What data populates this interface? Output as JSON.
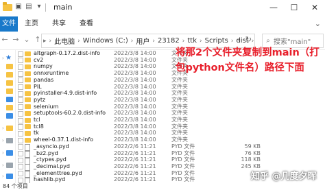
{
  "window": {
    "title": "main",
    "controls": [
      "—",
      "☐",
      "✕"
    ]
  },
  "ribbon": {
    "file_tab": "文件",
    "tabs": [
      "主页",
      "共享",
      "查看"
    ],
    "expand_icon": "chevron-down-icon"
  },
  "address_bar": {
    "segments": [
      "此电脑",
      "Windows (C:)",
      "用户",
      "23182",
      "ttk",
      "Scripts",
      "dist"
    ],
    "current": "main",
    "dropdown_glyph": "⌄",
    "refresh_glyph": "↻"
  },
  "search": {
    "placeholder": "搜索\"main\""
  },
  "files": [
    {
      "name": "altgraph-0.17.2.dist-info",
      "date": "2022/3/8 14:00",
      "type": "文件夹",
      "size": "",
      "kind": "folder"
    },
    {
      "name": "cv2",
      "date": "2022/3/8 14:00",
      "type": "文件夹",
      "size": "",
      "kind": "folder"
    },
    {
      "name": "numpy",
      "date": "2022/3/8 14:00",
      "type": "文件夹",
      "size": "",
      "kind": "folder"
    },
    {
      "name": "onnxruntime",
      "date": "2022/3/8 14:00",
      "type": "文件夹",
      "size": "",
      "kind": "folder"
    },
    {
      "name": "pandas",
      "date": "2022/3/8 14:00",
      "type": "文件夹",
      "size": "",
      "kind": "folder"
    },
    {
      "name": "PIL",
      "date": "2022/3/8 14:00",
      "type": "文件夹",
      "size": "",
      "kind": "folder"
    },
    {
      "name": "pyinstaller-4.9.dist-info",
      "date": "2022/3/8 14:00",
      "type": "文件夹",
      "size": "",
      "kind": "folder"
    },
    {
      "name": "pytz",
      "date": "2022/3/8 14:00",
      "type": "文件夹",
      "size": "",
      "kind": "folder"
    },
    {
      "name": "selenium",
      "date": "2022/3/8 14:00",
      "type": "文件夹",
      "size": "",
      "kind": "folder"
    },
    {
      "name": "setuptools-60.2.0.dist-info",
      "date": "2022/3/8 14:00",
      "type": "文件夹",
      "size": "",
      "kind": "folder"
    },
    {
      "name": "tcl",
      "date": "2022/3/8 14:00",
      "type": "文件夹",
      "size": "",
      "kind": "folder"
    },
    {
      "name": "tcl8",
      "date": "2022/3/8 14:00",
      "type": "文件夹",
      "size": "",
      "kind": "folder"
    },
    {
      "name": "tk",
      "date": "2022/3/8 14:00",
      "type": "文件夹",
      "size": "",
      "kind": "folder"
    },
    {
      "name": "wheel-0.37.1.dist-info",
      "date": "2022/3/8 14:00",
      "type": "文件夹",
      "size": "",
      "kind": "folder"
    },
    {
      "name": "_asyncio.pyd",
      "date": "2022/2/6 11:21",
      "type": "PYD 文件",
      "size": "59 KB",
      "kind": "file"
    },
    {
      "name": "_bz2.pyd",
      "date": "2022/2/6 11:21",
      "type": "PYD 文件",
      "size": "76 KB",
      "kind": "file"
    },
    {
      "name": "_ctypes.pyd",
      "date": "2022/2/6 11:21",
      "type": "PYD 文件",
      "size": "118 KB",
      "kind": "file"
    },
    {
      "name": "_decimal.pyd",
      "date": "2022/2/6 11:21",
      "type": "PYD 文件",
      "size": "245 KB",
      "kind": "file"
    },
    {
      "name": "_elementtree.pyd",
      "date": "2022/2/6 11:21",
      "type": "PYD 文件",
      "size": "",
      "kind": "file"
    },
    {
      "name": "hashlib.pyd",
      "date": "2022/2/6 11:21",
      "type": "PYD 文件",
      "size": "",
      "kind": "file"
    }
  ],
  "annotation": "将那2个文件夹复制到main（打包python文件名）路径下面",
  "watermark": "知乎 @几度夕晖",
  "status": {
    "count": "84 个项目"
  }
}
